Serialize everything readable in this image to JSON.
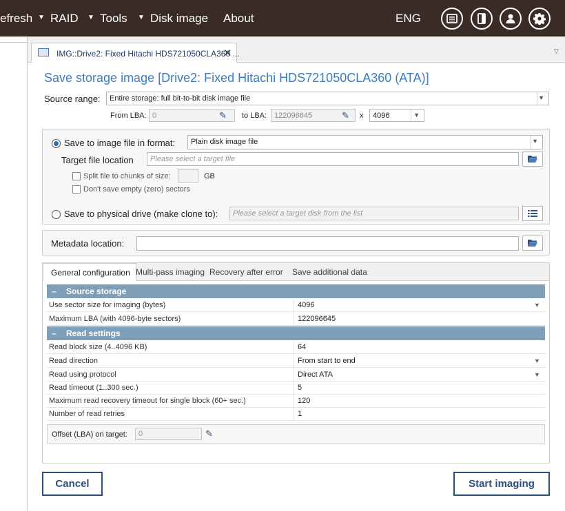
{
  "menu": {
    "items": [
      {
        "label": "efresh"
      },
      {
        "label": "RAID"
      },
      {
        "label": "Tools"
      },
      {
        "label": "Disk image"
      },
      {
        "label": "About"
      }
    ],
    "language": "ENG",
    "icons": [
      "panel-icon",
      "sidebar-icon",
      "user-icon",
      "settings-gear-icon"
    ]
  },
  "tab": {
    "label": "IMG::Drive2: Fixed Hitachi HDS721050CLA360 ...",
    "close": "✕"
  },
  "dialog": {
    "title": "Save storage image [Drive2: Fixed Hitachi HDS721050CLA360 (ATA)]",
    "source_range": {
      "label": "Source range:",
      "value": "Entire storage: full bit-to-bit disk image file",
      "from_label": "From LBA:",
      "from_value": "0",
      "to_label": "to LBA:",
      "to_value": "122096645",
      "x_label": "x",
      "block_value": "4096"
    },
    "save_to_file": {
      "label": "Save to image file in format:",
      "format": "Plain disk image file",
      "target_label": "Target file location",
      "target_placeholder": "Please select a target file",
      "split_label": "Split file to chunks of size:",
      "split_value": "",
      "split_unit": "GB",
      "empty_label": "Don't save empty (zero) sectors"
    },
    "save_to_drive": {
      "label": "Save to physical drive (make clone to):",
      "placeholder": "Please select a target disk from the list"
    },
    "metadata": {
      "label": "Metadata location:",
      "value": ""
    },
    "config_tabs": [
      "General configuration",
      "Multi-pass imaging",
      "Recovery after error",
      "Save additional data"
    ],
    "sections": [
      {
        "title": "Source storage",
        "rows": [
          {
            "name": "Use sector size for imaging (bytes)",
            "value": "4096",
            "dropdown": true
          },
          {
            "name": "Maximum LBA (with 4096-byte sectors)",
            "value": "122096645",
            "dropdown": false
          }
        ]
      },
      {
        "title": "Read settings",
        "rows": [
          {
            "name": "Read block size (4..4096 KB)",
            "value": "64",
            "dropdown": false
          },
          {
            "name": "Read direction",
            "value": "From start to end",
            "dropdown": true
          },
          {
            "name": "Read using protocol",
            "value": "Direct ATA",
            "dropdown": true
          },
          {
            "name": "Read timeout (1..300 sec.)",
            "value": "5",
            "dropdown": false
          },
          {
            "name": "Maximum read recovery timeout for single block (60+ sec.)",
            "value": "120",
            "dropdown": false
          },
          {
            "name": "Number of read retries",
            "value": "1",
            "dropdown": false
          }
        ]
      }
    ],
    "offset": {
      "label": "Offset (LBA) on target:",
      "value": "0"
    },
    "cancel_label": "Cancel",
    "start_label": "Start imaging"
  }
}
